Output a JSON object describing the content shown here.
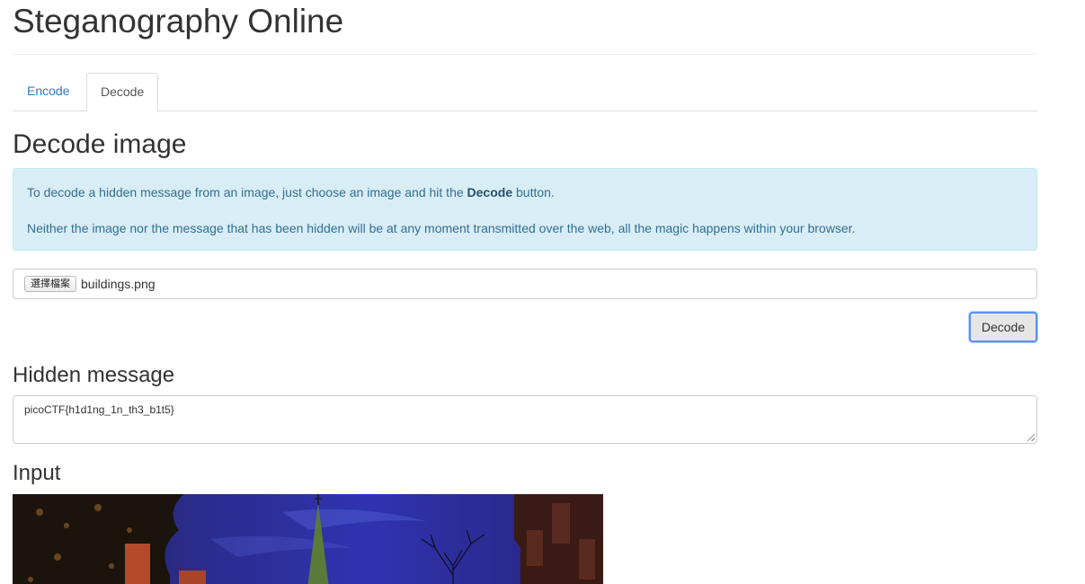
{
  "app": {
    "title": "Steganography Online"
  },
  "tabs": [
    {
      "label": "Encode",
      "active": false
    },
    {
      "label": "Decode",
      "active": true
    }
  ],
  "decode_section": {
    "title": "Decode image",
    "info": {
      "line1_prefix": "To decode a hidden message from an image, just choose an image and hit the ",
      "line1_bold": "Decode",
      "line1_suffix": " button.",
      "line2": "Neither the image nor the message that has been hidden will be at any moment transmitted over the web, all the magic happens within your browser."
    },
    "file_input": {
      "button_label": "選擇檔案",
      "file_name": "buildings.png"
    },
    "decode_button": "Decode"
  },
  "hidden_message": {
    "title": "Hidden message",
    "value": "picoCTF{h1d1ng_1n_th3_b1t5}"
  },
  "input_section": {
    "title": "Input"
  },
  "colors": {
    "link": "#337ab7",
    "alert_bg": "#d9edf7",
    "alert_text": "#31708f",
    "focus_ring": "#5b8ff7"
  }
}
